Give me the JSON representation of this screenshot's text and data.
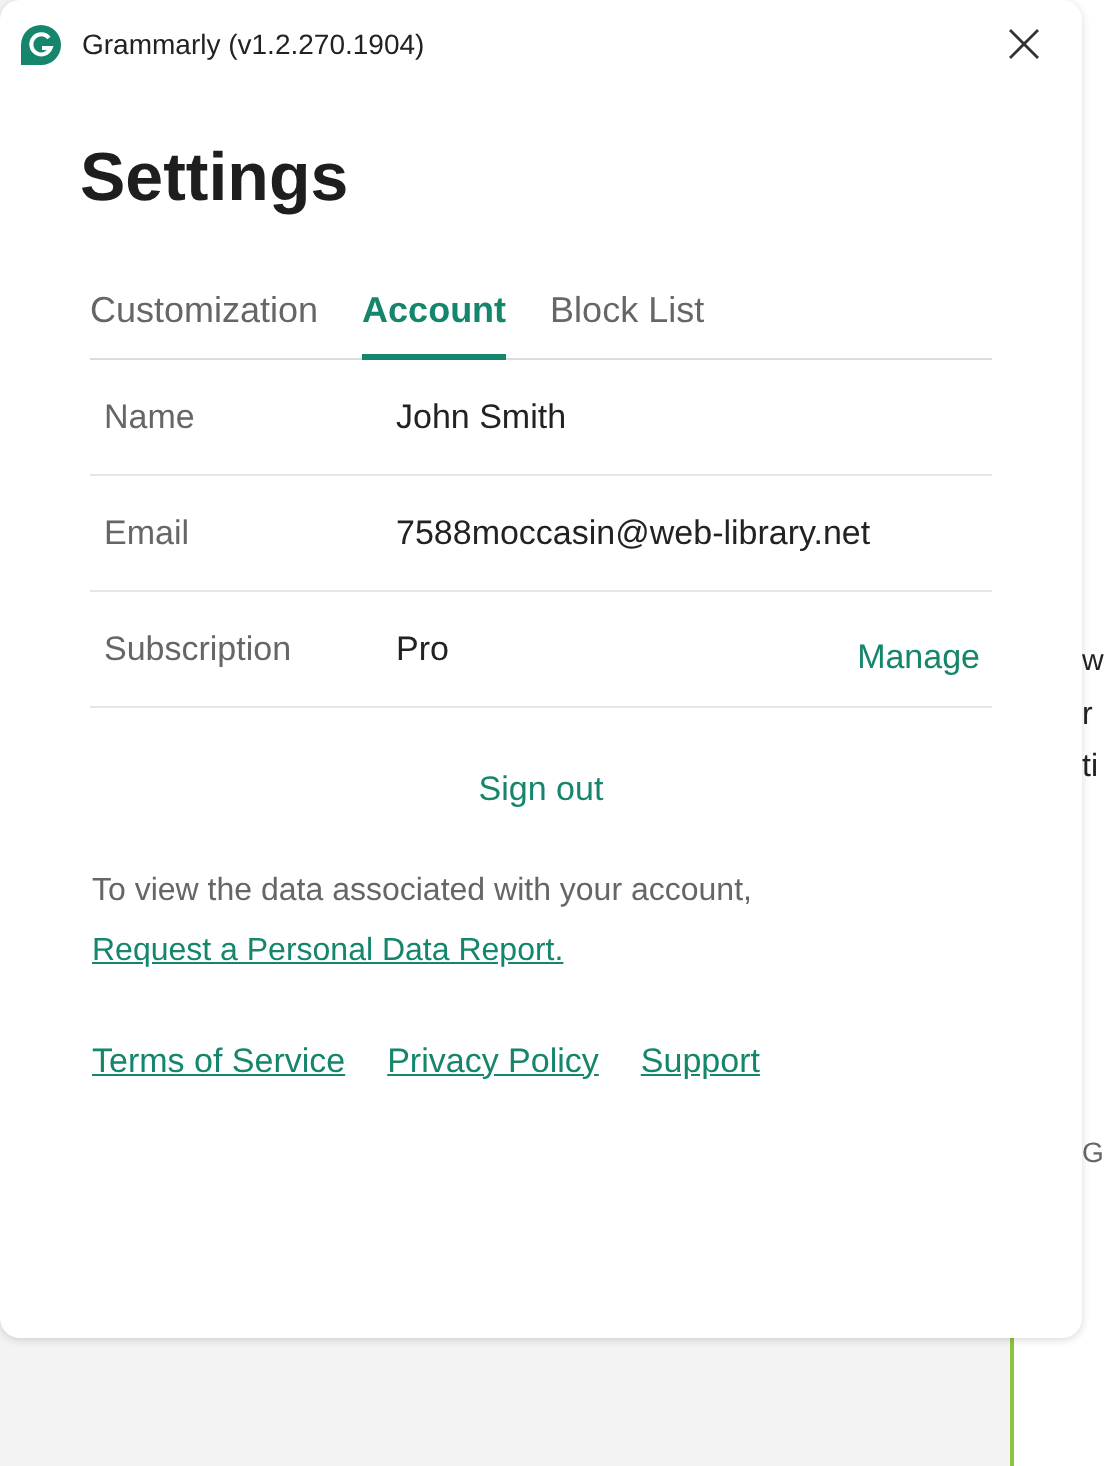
{
  "background": {
    "fragments": [
      "w",
      "r",
      "ti",
      "G"
    ]
  },
  "window": {
    "title": "Grammarly (v1.2.270.1904)"
  },
  "heading": "Settings",
  "tabs": [
    {
      "label": "Customization",
      "selected": false
    },
    {
      "label": "Account",
      "selected": true
    },
    {
      "label": "Block List",
      "selected": false
    }
  ],
  "account_rows": [
    {
      "label": "Name",
      "value": "John Smith"
    },
    {
      "label": "Email",
      "value": "7588moccasin@web-library.net"
    },
    {
      "label": "Subscription",
      "value": "Pro",
      "action": "Manage"
    }
  ],
  "sign_out": "Sign out",
  "data_note": {
    "text": "To view the data associated with your account,",
    "link": "Request a Personal Data Report."
  },
  "footer_links": [
    "Terms of Service",
    "Privacy Policy",
    "Support"
  ]
}
